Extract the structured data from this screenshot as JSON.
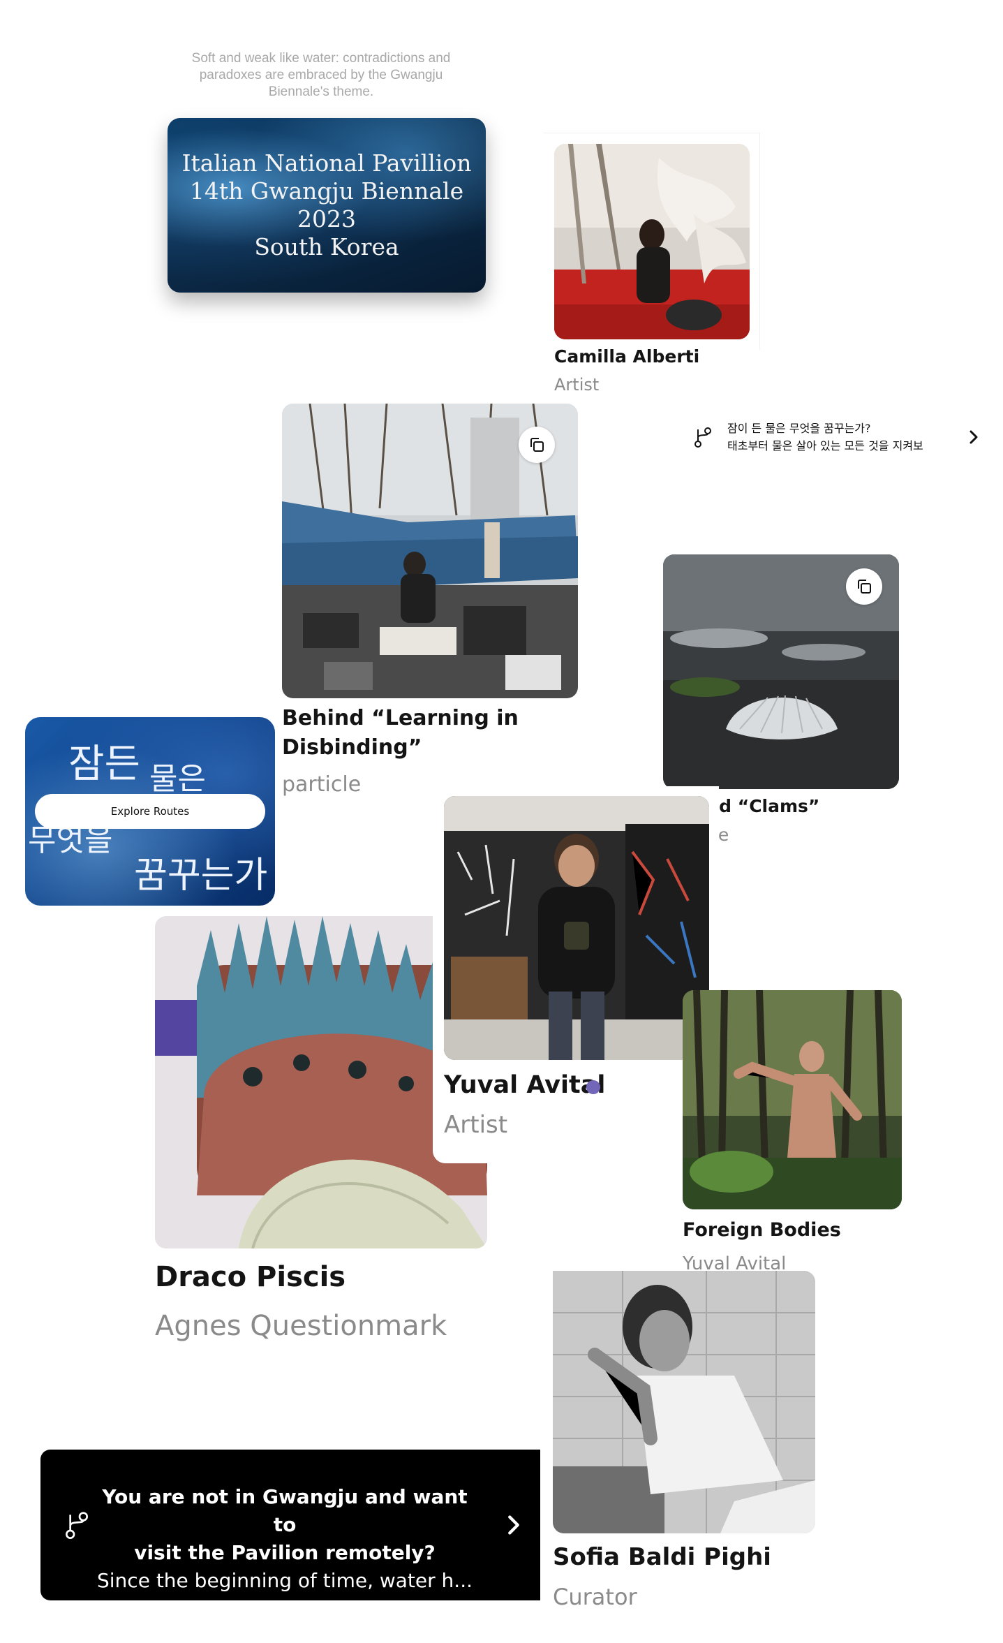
{
  "quote": {
    "text": "Soft and weak like water: contradictions and paradoxes are embraced by the Gwangju Biennale's theme."
  },
  "pavilion_card": {
    "line1": "Italian National Pavillion",
    "line2": "14th Gwangju Biennale 2023",
    "line3": "South Korea"
  },
  "cards": {
    "camilla": {
      "title": "Camilla Alberti",
      "subtitle": "Artist"
    },
    "learning": {
      "title_line1": "Behind “Learning in",
      "title_line2": "Disbinding”",
      "subtitle": "particle"
    },
    "clams": {
      "title": "Behind “Clams”",
      "subtitle": "particle"
    },
    "yuval": {
      "title": "Yuval Avital",
      "subtitle": "Artist"
    },
    "foreign": {
      "title": "Foreign Bodies",
      "subtitle": "Yuval Avital"
    },
    "draco": {
      "title": "Draco Piscis",
      "subtitle": "Agnes Questionmark"
    },
    "sofia": {
      "title": "Sofia Baldi Pighi",
      "subtitle": "Curator"
    }
  },
  "korean_route": {
    "line1": "잠이 든 물은 무엇을 꿈꾸는가?",
    "line2": "태초부터 물은 살아 있는 모든 것을 지켜보"
  },
  "explore_card": {
    "kr_line1a": "잠든",
    "kr_line1b": "물은",
    "kr_line2": "무엇을",
    "kr_line3": "꿈꾸는가",
    "button_label": "Explore Routes"
  },
  "remote_banner": {
    "line1": "You are not in Gwangju and want to",
    "line2": "visit the Pavilion remotely?",
    "line3": "Since the beginning of time, water h..."
  },
  "icons": {
    "route": "route-icon",
    "chevron": "chevron-right-icon",
    "copy": "copy-icon"
  },
  "colors": {
    "accent_dot": "#7166b8",
    "title": "#141414",
    "subtitle": "#8a8a8a",
    "banner_bg": "#000000"
  }
}
